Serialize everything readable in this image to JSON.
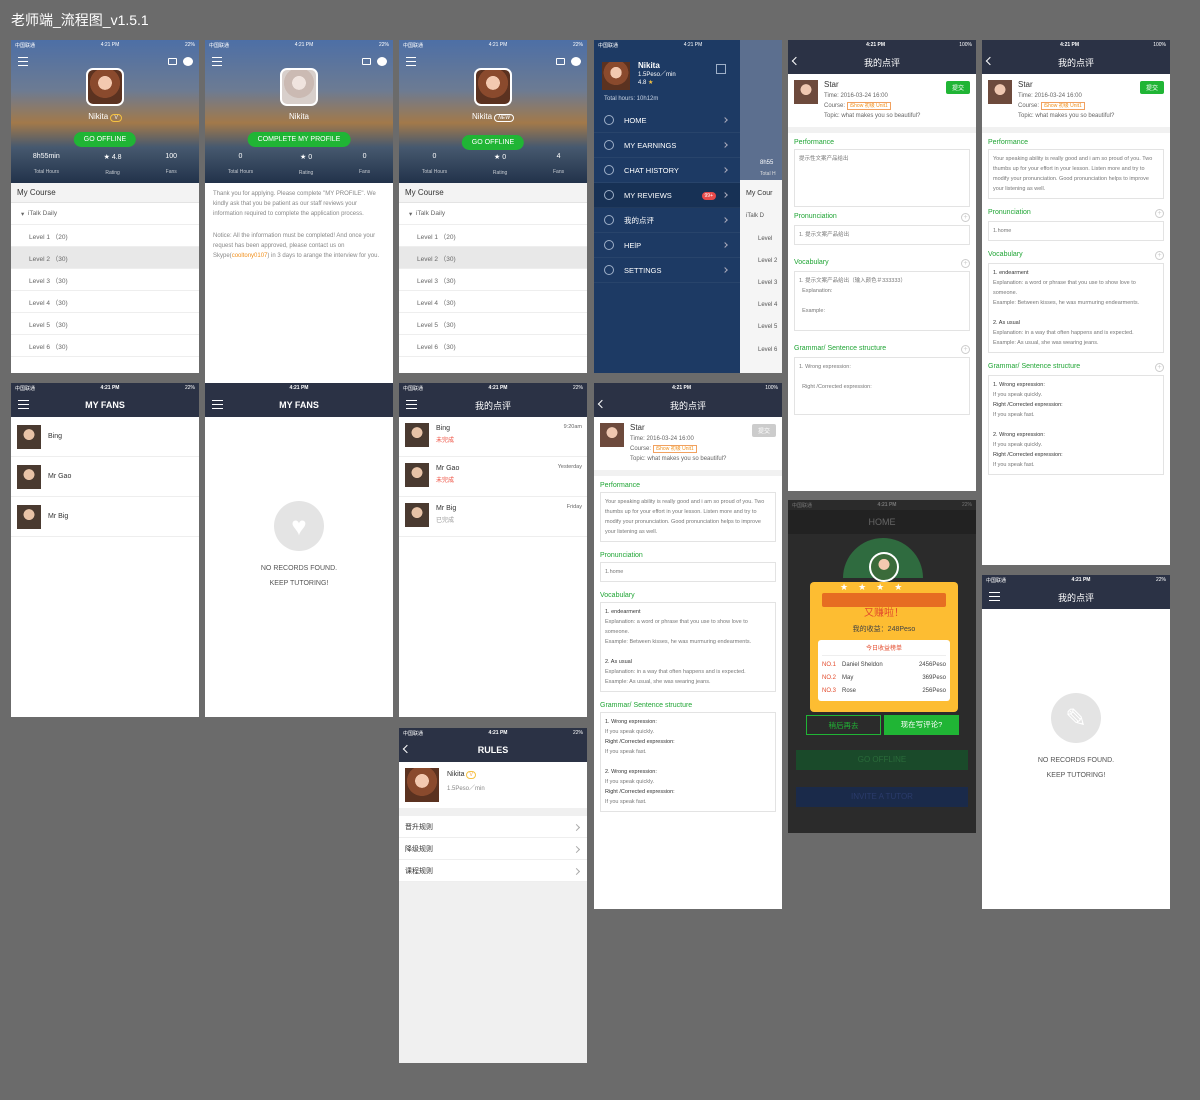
{
  "title": "老师端_流程图_v1.5.1",
  "status": {
    "carrier": "中国联通",
    "time": "4:21 PM",
    "battery": "22%",
    "battery_full": "100%"
  },
  "home": {
    "name": "Nikita",
    "level": "V",
    "new": "NEW",
    "offline": "GO OFFLINE",
    "complete": "COMPLETE MY PROFILE",
    "stats": [
      {
        "v": "8h55min",
        "l": "Total Hours"
      },
      {
        "v": "4.8",
        "l": "Rating"
      },
      {
        "v": "100",
        "l": "Fans"
      }
    ],
    "stats0": [
      {
        "v": "0",
        "l": "Total Hours"
      },
      {
        "v": "0",
        "l": "Rating"
      },
      {
        "v": "0",
        "l": "Fans"
      }
    ],
    "stats2": [
      {
        "v": "0",
        "l": "Total Hours"
      },
      {
        "v": "0",
        "l": "Rating"
      },
      {
        "v": "4",
        "l": "Fans"
      }
    ],
    "course_title": "My Course",
    "course": "iTalk Daily",
    "levels": [
      "Level 1 （20)",
      "Level 2 （30)",
      "Level 3 （30)",
      "Level 4 （30)",
      "Level 5 （30)",
      "Level 6 （30)"
    ],
    "apply_p1": "Thank you for applying. Please complete \"MY PROFILE\". We kindly ask that you be patient as our staff reviews your information required to complete the application process.",
    "apply_p2a": "Notice: All the information must be completed! And once your request has been approved, please contact us on Skype(",
    "skype": "cooltony0107",
    "apply_p2b": ") in 3 days to arange the interview for you."
  },
  "drawer": {
    "name": "Nikita",
    "rate": "1.5Peso／min",
    "rating": "4.8",
    "hours": "Total hours: 10h12m",
    "badge": "99+",
    "menu": [
      "HOME",
      "MY EARNINGS",
      "CHAT HISTORY",
      "MY REVIEWS",
      "我的点评",
      "HElP",
      "SETTINGS"
    ],
    "peek": [
      "8h55",
      "Total H",
      "My Cour",
      "iTalk D",
      "Level",
      "Level 2",
      "Level 3",
      "Level 4",
      "Level 5",
      "Level 6"
    ]
  },
  "fans": {
    "title": "MY FANS",
    "items": [
      "Bing",
      "Mr Gao",
      "Mr Big"
    ],
    "empty1": "NO RECORDS FOUND.",
    "empty2": "KEEP TUTORING!"
  },
  "reviews": {
    "title": "我的点评",
    "items": [
      {
        "n": "Bing",
        "s": "未完成",
        "t": "9:20am"
      },
      {
        "n": "Mr Gao",
        "s": "未完成",
        "t": "Yesterday"
      },
      {
        "n": "Mr Big",
        "s": "已完成",
        "t": "Friday"
      }
    ]
  },
  "rules": {
    "title": "RULES",
    "name": "Nikita",
    "v": "V",
    "rate": "1.5Peso／min",
    "items": [
      "晋升规则",
      "降级规则",
      "课程规则"
    ]
  },
  "detail": {
    "title": "我的点评",
    "name": "Star",
    "time": "Time:  2016-03-24 16:00",
    "course_l": "Course:",
    "course": "iShow 初级 Unit1",
    "topic": "Topic:  what makes you so beautiful?",
    "submit": "提交",
    "perf": "Performance",
    "pron": "Pronunciation",
    "vocab": "Vocabulary",
    "gram": "Grammar/ Sentence structure",
    "perf_ph": "提示性文案产品给出",
    "pron_ph": "1. 提示文案产品给出",
    "vocab_ph": "1. 提示文案产品给出（输入颜色＃333333）",
    "expl": "Explanation:",
    "example": "Example:",
    "wrong": "1. Wrong expression:",
    "right": "Right /Corrected expression:",
    "perf_txt": "Your speaking ability is really good and i am so proud of you. Two thumbs up for your effort in your lesson. Listen more and try to modify your pronunciation. Good pronunciation helps to improve your listening as well.",
    "pron_txt": "1.home",
    "v1": "1. endearment",
    "v1e": "Explanation: a word or phrase that you use to show love to someone.",
    "v1x": "Example: Between kisses, he was murmuring endearments.",
    "v2": "2. As usual",
    "v2e": "Explanation: in a way that often happens and is expected.",
    "v2x": "Example: As usual, she was wearing jeans.",
    "g1": "1. Wrong expression:",
    "g1a": "If you speak quickly.",
    "g1b": "Right /Corrected expression:",
    "g1c": "If you speak fast.",
    "g2": "2. Wrong expression:"
  },
  "popup": {
    "nav": "HOME",
    "title": "又赚啦！",
    "income": "我的收益：248Peso",
    "board": "今日收益榜单",
    "rows": [
      {
        "r": "NO.1",
        "n": "Daniel Sheldon",
        "p": "2456Peso"
      },
      {
        "r": "NO.2",
        "n": "May",
        "p": "369Peso"
      },
      {
        "r": "NO.3",
        "n": "Rose",
        "p": "256Peso"
      }
    ],
    "later": "稍后再去",
    "now": "现在写评论?",
    "offline": "GO OFFLINE",
    "invite": "INVITE A TUTOR"
  }
}
